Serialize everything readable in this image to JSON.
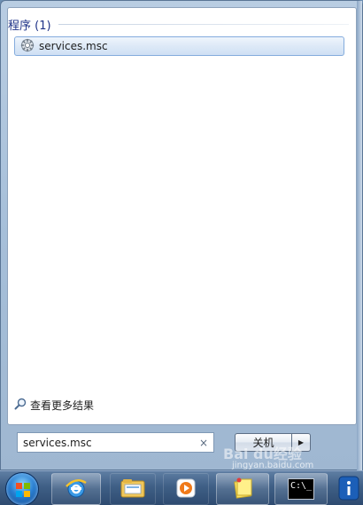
{
  "start_menu": {
    "section_title": "程序 (1)",
    "result_item": {
      "label": "services.msc",
      "icon": "services-gear-icon"
    },
    "see_more_label": "查看更多结果",
    "search": {
      "value": "services.msc",
      "clear_glyph": "×"
    },
    "shutdown": {
      "label": "关机",
      "arrow_glyph": "▶"
    }
  },
  "taskbar": {
    "items": [
      {
        "name": "start-orb",
        "icon": "windows-logo-icon"
      },
      {
        "name": "internet-explorer",
        "icon": "ie-icon"
      },
      {
        "name": "windows-explorer",
        "icon": "folder-icon"
      },
      {
        "name": "media-player",
        "icon": "media-player-icon"
      },
      {
        "name": "sticky-notes",
        "icon": "sticky-notes-icon"
      },
      {
        "name": "command-prompt",
        "icon": "cmd-icon",
        "label": "C:\\_"
      },
      {
        "name": "info",
        "icon": "info-icon",
        "glyph": "i"
      }
    ]
  },
  "watermark": {
    "text": "Bai du经验",
    "sub": "jingyan.baidu.com"
  },
  "colors": {
    "accent": "#1e3287",
    "highlight_border": "#84acdd",
    "taskbar": "#3f5f86"
  }
}
